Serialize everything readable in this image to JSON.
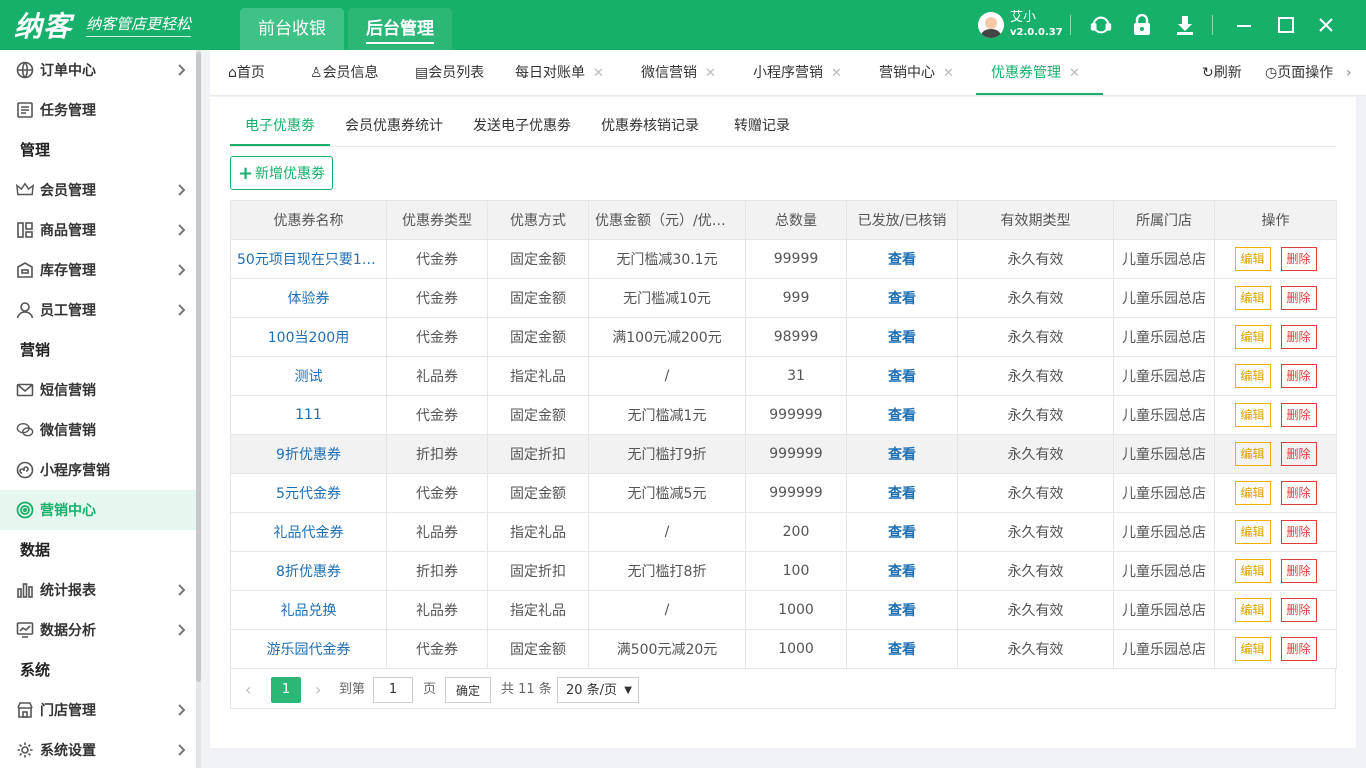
{
  "app": {
    "slogan": "纳客管店更轻松",
    "logo_text": "纳客",
    "top_tabs": [
      "前台收银",
      "后台管理"
    ],
    "user_name": "艾小",
    "version": "v2.0.0.37"
  },
  "sidebar": {
    "items": [
      {
        "type": "item",
        "label": "订单中心",
        "icon": "clipboard-icon",
        "arrow": true
      },
      {
        "type": "item",
        "label": "任务管理",
        "icon": "task-icon",
        "arrow": false
      },
      {
        "type": "group",
        "label": "管理"
      },
      {
        "type": "item",
        "label": "会员管理",
        "icon": "crown-icon",
        "arrow": true
      },
      {
        "type": "item",
        "label": "商品管理",
        "icon": "goods-icon",
        "arrow": true
      },
      {
        "type": "item",
        "label": "库存管理",
        "icon": "inventory-icon",
        "arrow": true
      },
      {
        "type": "item",
        "label": "员工管理",
        "icon": "user-icon",
        "arrow": true
      },
      {
        "type": "group",
        "label": "营销"
      },
      {
        "type": "item",
        "label": "短信营销",
        "icon": "mail-icon",
        "arrow": false
      },
      {
        "type": "item",
        "label": "微信营销",
        "icon": "wechat-icon",
        "arrow": false
      },
      {
        "type": "item",
        "label": "小程序营销",
        "icon": "miniprogram-icon",
        "arrow": false
      },
      {
        "type": "item",
        "label": "营销中心",
        "icon": "target-icon",
        "arrow": false,
        "active": true
      },
      {
        "type": "group",
        "label": "数据"
      },
      {
        "type": "item",
        "label": "统计报表",
        "icon": "bar-chart-icon",
        "arrow": true
      },
      {
        "type": "item",
        "label": "数据分析",
        "icon": "monitor-chart-icon",
        "arrow": true
      },
      {
        "type": "group",
        "label": "系统"
      },
      {
        "type": "item",
        "label": "门店管理",
        "icon": "store-icon",
        "arrow": true
      },
      {
        "type": "item",
        "label": "系统设置",
        "icon": "gear-icon",
        "arrow": true
      }
    ]
  },
  "tabbar": {
    "tabs": [
      {
        "label": "首页",
        "icon": "home-icon",
        "closable": false
      },
      {
        "label": "会员信息",
        "icon": "user-icon",
        "closable": false
      },
      {
        "label": "会员列表",
        "icon": "list-icon",
        "closable": false
      },
      {
        "label": "每日对账单",
        "closable": true
      },
      {
        "label": "微信营销",
        "closable": true
      },
      {
        "label": "小程序营销",
        "closable": true
      },
      {
        "label": "营销中心",
        "closable": true
      },
      {
        "label": "优惠券管理",
        "closable": true,
        "active": true
      }
    ],
    "refresh": "刷新",
    "page_ops": "页面操作"
  },
  "subtabs": [
    "电子优惠劵",
    "会员优惠券统计",
    "发送电子优惠劵",
    "优惠券核销记录",
    "转赠记录"
  ],
  "add_button": "新增优惠劵",
  "table": {
    "headers": [
      "优惠券名称",
      "优惠券类型",
      "优惠方式",
      "优惠金额（元）/优惠...",
      "总数量",
      "已发放/已核销",
      "有效期类型",
      "所属门店",
      "操作"
    ],
    "rows": [
      [
        "50元项目现在只要19....",
        "代金券",
        "固定金额",
        "无门槛减30.1元",
        "99999",
        "查看",
        "永久有效",
        "儿童乐园总店"
      ],
      [
        "体验券",
        "代金券",
        "固定金额",
        "无门槛减10元",
        "999",
        "查看",
        "永久有效",
        "儿童乐园总店"
      ],
      [
        "100当200用",
        "代金券",
        "固定金额",
        "满100元减200元",
        "98999",
        "查看",
        "永久有效",
        "儿童乐园总店"
      ],
      [
        "测试",
        "礼品券",
        "指定礼品",
        "/",
        "31",
        "查看",
        "永久有效",
        "儿童乐园总店"
      ],
      [
        "111",
        "代金券",
        "固定金额",
        "无门槛减1元",
        "999999",
        "查看",
        "永久有效",
        "儿童乐园总店"
      ],
      [
        "9折优惠券",
        "折扣券",
        "固定折扣",
        "无门槛打9折",
        "999999",
        "查看",
        "永久有效",
        "儿童乐园总店"
      ],
      [
        "5元代金券",
        "代金券",
        "固定金额",
        "无门槛减5元",
        "999999",
        "查看",
        "永久有效",
        "儿童乐园总店"
      ],
      [
        "礼品代金券",
        "礼品券",
        "指定礼品",
        "/",
        "200",
        "查看",
        "永久有效",
        "儿童乐园总店"
      ],
      [
        "8折优惠券",
        "折扣券",
        "固定折扣",
        "无门槛打8折",
        "100",
        "查看",
        "永久有效",
        "儿童乐园总店"
      ],
      [
        "礼品兑换",
        "礼品券",
        "指定礼品",
        "/",
        "1000",
        "查看",
        "永久有效",
        "儿童乐园总店"
      ],
      [
        "游乐园代金券",
        "代金券",
        "固定金额",
        "满500元减20元",
        "1000",
        "查看",
        "永久有效",
        "儿童乐园总店"
      ]
    ],
    "highlighted_row": 5,
    "edit_label": "编辑",
    "delete_label": "删除"
  },
  "pager": {
    "current_page": "1",
    "goto_label": "到第",
    "page_input": "1",
    "page_unit": "页",
    "confirm": "确定",
    "total": "共 11 条",
    "page_size": "20 条/页"
  },
  "colors": {
    "brand": "#17b06b",
    "link": "#1f6fb5",
    "edit": "#f0b000",
    "delete": "#e03c3c"
  }
}
